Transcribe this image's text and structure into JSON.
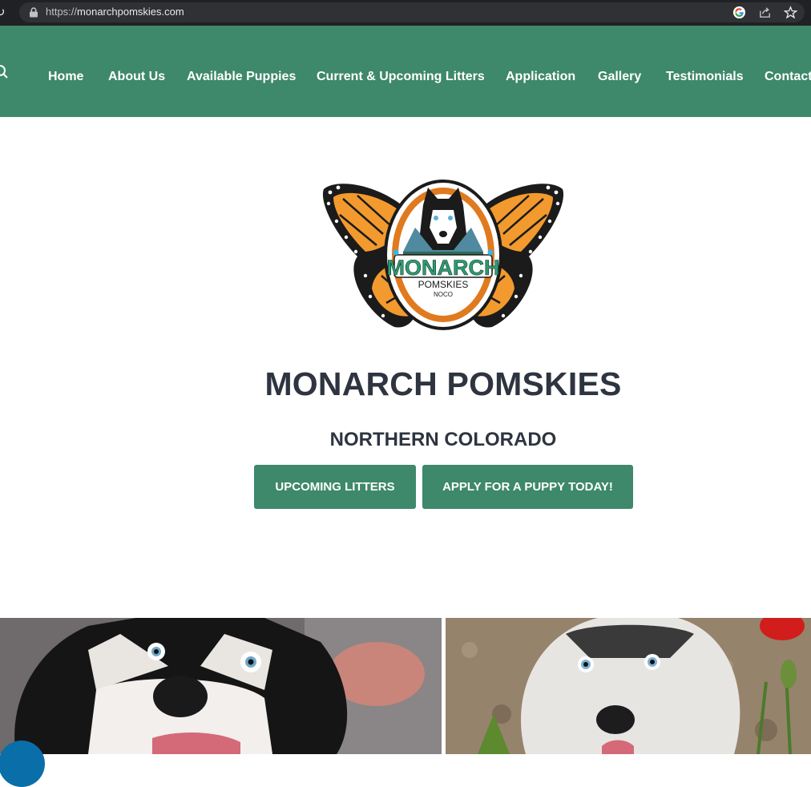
{
  "browser": {
    "url_scheme": "https://",
    "url_host": "monarchpomskies.com"
  },
  "nav": {
    "items": [
      {
        "label": "Home"
      },
      {
        "label": "About Us"
      },
      {
        "label": "Available Puppies"
      },
      {
        "label": "Current & Upcoming Litters"
      },
      {
        "label": "Application"
      },
      {
        "label": "Gallery"
      },
      {
        "label": "Testimonials"
      },
      {
        "label": "Contact"
      }
    ]
  },
  "logo": {
    "name": "MONARCH",
    "sub": "POMSKIES",
    "region": "NOCO"
  },
  "hero": {
    "title": "MONARCH POMSKIES",
    "subtitle": "NORTHERN COLORADO",
    "buttons": [
      {
        "label": "UPCOMING LITTERS"
      },
      {
        "label": "APPLY FOR A PUPPY TODAY!"
      }
    ]
  },
  "colors": {
    "brand_green": "#3e886b",
    "heading": "#2e3540",
    "monarch_orange": "#f29a2e",
    "chat_blue": "#0a6ea8"
  }
}
